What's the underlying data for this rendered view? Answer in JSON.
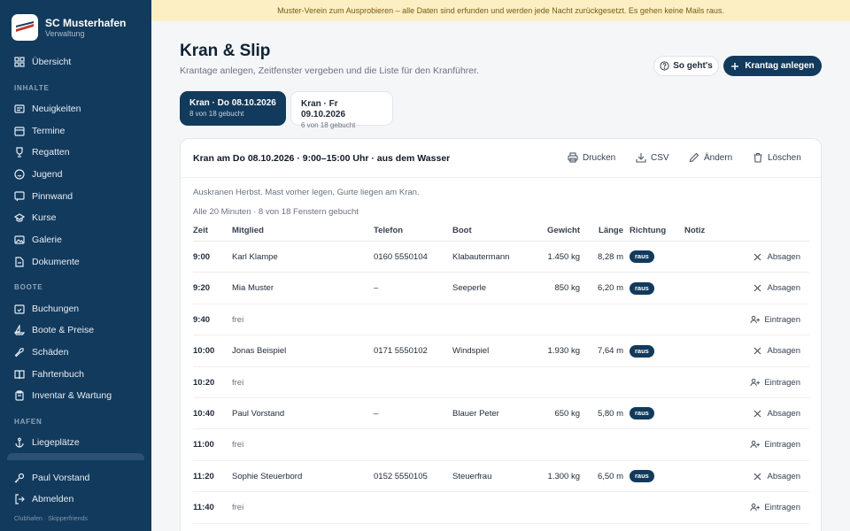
{
  "brand": {
    "name": "SC Musterhafen",
    "subtitle": "Verwaltung"
  },
  "sidebar": {
    "overview": {
      "label": "Übersicht",
      "icon": "dashboard-icon"
    },
    "sections": [
      {
        "title": "INHALTE",
        "items": [
          {
            "label": "Neuigkeiten",
            "icon": "newspaper-icon"
          },
          {
            "label": "Termine",
            "icon": "calendar-icon"
          },
          {
            "label": "Regatten",
            "icon": "trophy-icon"
          },
          {
            "label": "Jugend",
            "icon": "smiley-icon"
          },
          {
            "label": "Pinnwand",
            "icon": "pin-icon"
          },
          {
            "label": "Kurse",
            "icon": "graduation-cap-icon"
          },
          {
            "label": "Galerie",
            "icon": "image-icon"
          },
          {
            "label": "Dokumente",
            "icon": "document-icon"
          }
        ]
      },
      {
        "title": "BOOTE",
        "items": [
          {
            "label": "Buchungen",
            "icon": "calendar-check-icon"
          },
          {
            "label": "Boote & Preise",
            "icon": "sailboat-icon"
          },
          {
            "label": "Schäden",
            "icon": "wrench-icon"
          },
          {
            "label": "Fahrtenbuch",
            "icon": "book-icon"
          },
          {
            "label": "Inventar & Wartung",
            "icon": "clipboard-icon"
          }
        ]
      },
      {
        "title": "HAFEN",
        "items": [
          {
            "label": "Liegeplätze",
            "icon": "anchor-icon"
          }
        ]
      }
    ],
    "user": "Paul Vorstand",
    "logout": "Abmelden",
    "footer": "Clubhafen · Skipperfriends"
  },
  "banner": "Muster-Verein zum Ausprobieren – alle Daten sind erfunden und werden jede Nacht zurückgesetzt. Es gehen keine Mails raus.",
  "header": {
    "title": "Kran & Slip",
    "subtitle": "Krantage anlegen, Zeitfenster vergeben und die Liste für den Kranführer.",
    "help_label": "So geht's",
    "primary_label": "Krantag anlegen"
  },
  "tabs": [
    {
      "title": "Kran · Do 08.10.2026",
      "sub": "8 von 18 gebucht"
    },
    {
      "title": "Kran · Fr 09.10.2026",
      "sub": "6 von 18 gebucht"
    }
  ],
  "card": {
    "title": "Kran am Do 08.10.2026 · 9:00–15:00 Uhr · aus dem Wasser",
    "actions": {
      "print": "Drucken",
      "csv": "CSV",
      "edit": "Ändern",
      "delete": "Löschen"
    },
    "description": "Auskranen Herbst. Mast vorher legen, Gurte liegen am Kran.",
    "meta": "Alle 20 Minuten · 8 von 18 Fenstern gebucht",
    "columns": {
      "time": "Zeit",
      "member": "Mitglied",
      "phone": "Telefon",
      "boat": "Boot",
      "weight": "Gewicht",
      "length": "Länge",
      "direction": "Richtung",
      "note": "Notiz"
    },
    "rows": [
      {
        "time": "9:00",
        "member": "Karl Klampe",
        "phone": "0160 5550104",
        "boat": "Klabautermann",
        "weight": "1.450 kg",
        "length": "8,28 m",
        "direction": "raus",
        "action": "Absagen"
      },
      {
        "time": "9:20",
        "member": "Mia Muster",
        "phone": "–",
        "boat": "Seeperle",
        "weight": "850 kg",
        "length": "6,20 m",
        "direction": "raus",
        "action": "Absagen"
      },
      {
        "time": "9:40",
        "member": "frei",
        "phone": "",
        "boat": "",
        "weight": "",
        "length": "",
        "direction": "",
        "action": "Eintragen"
      },
      {
        "time": "10:00",
        "member": "Jonas Beispiel",
        "phone": "0171 5550102",
        "boat": "Windspiel",
        "weight": "1.930 kg",
        "length": "7,64 m",
        "direction": "raus",
        "action": "Absagen"
      },
      {
        "time": "10:20",
        "member": "frei",
        "phone": "",
        "boat": "",
        "weight": "",
        "length": "",
        "direction": "",
        "action": "Eintragen"
      },
      {
        "time": "10:40",
        "member": "Paul Vorstand",
        "phone": "–",
        "boat": "Blauer Peter",
        "weight": "650 kg",
        "length": "5,80 m",
        "direction": "raus",
        "action": "Absagen"
      },
      {
        "time": "11:00",
        "member": "frei",
        "phone": "",
        "boat": "",
        "weight": "",
        "length": "",
        "direction": "",
        "action": "Eintragen"
      },
      {
        "time": "11:20",
        "member": "Sophie Steuerbord",
        "phone": "0152 5550105",
        "boat": "Steuerfrau",
        "weight": "1.300 kg",
        "length": "6,50 m",
        "direction": "raus",
        "action": "Absagen"
      },
      {
        "time": "11:40",
        "member": "frei",
        "phone": "",
        "boat": "",
        "weight": "",
        "length": "",
        "direction": "",
        "action": "Eintragen"
      }
    ]
  },
  "colors": {
    "navy": "#123a5c",
    "banner_bg": "#fcefc4",
    "banner_text": "#7a5b12"
  }
}
